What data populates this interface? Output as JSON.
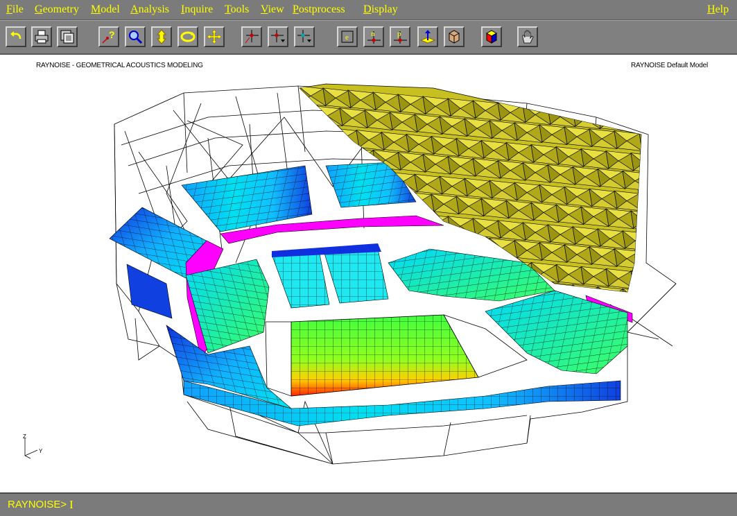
{
  "menu": {
    "items": [
      {
        "label": "File"
      },
      {
        "label": "Geometry"
      },
      {
        "label": "Model"
      },
      {
        "label": "Analysis"
      },
      {
        "label": "Inquire"
      },
      {
        "label": "Tools"
      },
      {
        "label": "View"
      },
      {
        "label": "Postprocess"
      },
      {
        "label": "Display"
      }
    ],
    "help": "Help"
  },
  "toolbar": {
    "buttons": [
      {
        "icon": "undo-icon"
      },
      {
        "icon": "print-icon"
      },
      {
        "icon": "copy-window-icon"
      },
      {
        "icon": "query-icon"
      },
      {
        "icon": "zoom-icon"
      },
      {
        "icon": "rotate-icon"
      },
      {
        "icon": "spin-icon"
      },
      {
        "icon": "pan-icon"
      },
      {
        "icon": "pick-node-icon"
      },
      {
        "icon": "pick-element-icon"
      },
      {
        "icon": "pick-face-icon"
      },
      {
        "icon": "element-label-icon",
        "glyph": "e"
      },
      {
        "icon": "node-label-icon",
        "glyph": "n"
      },
      {
        "icon": "point-label-icon",
        "glyph": "p"
      },
      {
        "icon": "normal-vector-icon"
      },
      {
        "icon": "hidden-surface-icon"
      },
      {
        "icon": "shaded-cube-icon"
      },
      {
        "icon": "hand-icon"
      }
    ]
  },
  "viewport": {
    "title_left": "RAYNOISE - GEOMETRICAL ACOUSTICS MODELING",
    "title_right": "RAYNOISE Default Model",
    "triad": {
      "z": "Z",
      "y": "Y"
    }
  },
  "command": {
    "prompt": "RAYNOISE>",
    "value": ""
  },
  "colors": {
    "panel": "#7b7b7b",
    "menu_text": "#ffff00",
    "roof": "#c8c020",
    "balcony_rail": "#ff00ff",
    "mesh_low": "#1030e0",
    "mesh_mid": "#00d8ff",
    "mesh_high": "#ff2000"
  }
}
